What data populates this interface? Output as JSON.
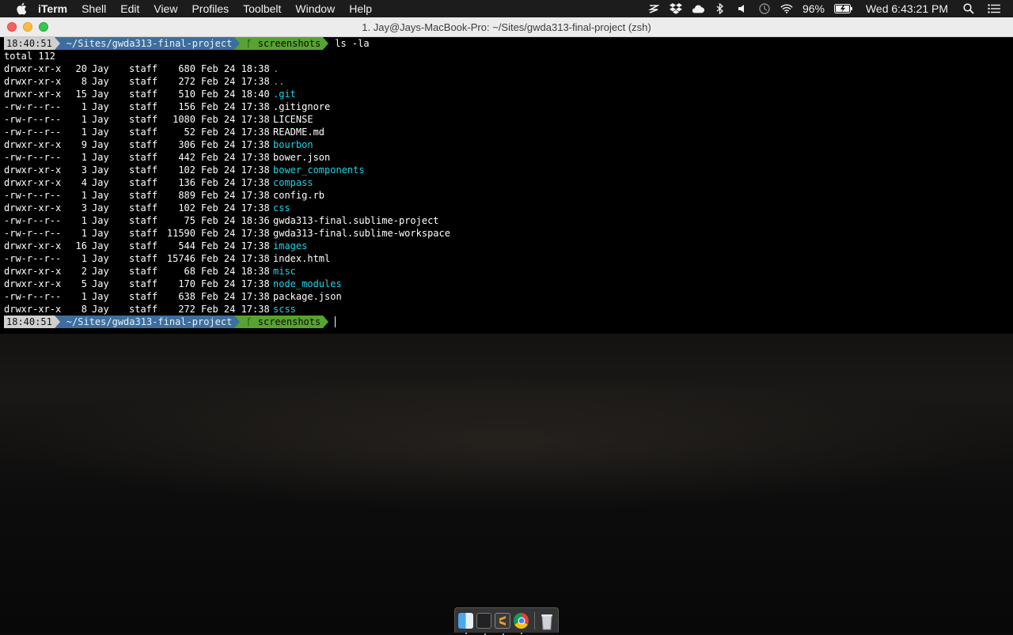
{
  "menubar": {
    "app_name": "iTerm",
    "menus": [
      "Shell",
      "Edit",
      "View",
      "Profiles",
      "Toolbelt",
      "Window",
      "Help"
    ],
    "battery_percent": "96%",
    "clock": "Wed 6:43:21 PM",
    "status_icons": [
      "dropbox-s-icon",
      "dropbox-icon",
      "cloud-icon",
      "bluetooth-icon",
      "volume-icon",
      "time-machine-icon",
      "wifi-icon",
      "battery-icon",
      "spotlight-icon",
      "notification-center-icon"
    ]
  },
  "window": {
    "title": "1. Jay@Jays-MacBook-Pro: ~/Sites/gwda313-final-project (zsh)"
  },
  "terminal": {
    "prompt1": {
      "time": "18:40:51",
      "path": "~/Sites/gwda313-final-project",
      "branch": "screenshots",
      "command": "ls -la"
    },
    "total_line": "total 112",
    "entries": [
      {
        "perm": "drwxr-xr-x",
        "links": "20",
        "owner": "Jay",
        "group": "staff",
        "size": "680",
        "date": "Feb 24 18:38",
        "name": ".",
        "dir": true
      },
      {
        "perm": "drwxr-xr-x",
        "links": "8",
        "owner": "Jay",
        "group": "staff",
        "size": "272",
        "date": "Feb 24 17:38",
        "name": "..",
        "dir": true
      },
      {
        "perm": "drwxr-xr-x",
        "links": "15",
        "owner": "Jay",
        "group": "staff",
        "size": "510",
        "date": "Feb 24 18:40",
        "name": ".git",
        "dir": true
      },
      {
        "perm": "-rw-r--r--",
        "links": "1",
        "owner": "Jay",
        "group": "staff",
        "size": "156",
        "date": "Feb 24 17:38",
        "name": ".gitignore",
        "dir": false
      },
      {
        "perm": "-rw-r--r--",
        "links": "1",
        "owner": "Jay",
        "group": "staff",
        "size": "1080",
        "date": "Feb 24 17:38",
        "name": "LICENSE",
        "dir": false
      },
      {
        "perm": "-rw-r--r--",
        "links": "1",
        "owner": "Jay",
        "group": "staff",
        "size": "52",
        "date": "Feb 24 17:38",
        "name": "README.md",
        "dir": false
      },
      {
        "perm": "drwxr-xr-x",
        "links": "9",
        "owner": "Jay",
        "group": "staff",
        "size": "306",
        "date": "Feb 24 17:38",
        "name": "bourbon",
        "dir": true
      },
      {
        "perm": "-rw-r--r--",
        "links": "1",
        "owner": "Jay",
        "group": "staff",
        "size": "442",
        "date": "Feb 24 17:38",
        "name": "bower.json",
        "dir": false
      },
      {
        "perm": "drwxr-xr-x",
        "links": "3",
        "owner": "Jay",
        "group": "staff",
        "size": "102",
        "date": "Feb 24 17:38",
        "name": "bower_components",
        "dir": true
      },
      {
        "perm": "drwxr-xr-x",
        "links": "4",
        "owner": "Jay",
        "group": "staff",
        "size": "136",
        "date": "Feb 24 17:38",
        "name": "compass",
        "dir": true
      },
      {
        "perm": "-rw-r--r--",
        "links": "1",
        "owner": "Jay",
        "group": "staff",
        "size": "889",
        "date": "Feb 24 17:38",
        "name": "config.rb",
        "dir": false
      },
      {
        "perm": "drwxr-xr-x",
        "links": "3",
        "owner": "Jay",
        "group": "staff",
        "size": "102",
        "date": "Feb 24 17:38",
        "name": "css",
        "dir": true
      },
      {
        "perm": "-rw-r--r--",
        "links": "1",
        "owner": "Jay",
        "group": "staff",
        "size": "75",
        "date": "Feb 24 18:36",
        "name": "gwda313-final.sublime-project",
        "dir": false
      },
      {
        "perm": "-rw-r--r--",
        "links": "1",
        "owner": "Jay",
        "group": "staff",
        "size": "11590",
        "date": "Feb 24 17:38",
        "name": "gwda313-final.sublime-workspace",
        "dir": false
      },
      {
        "perm": "drwxr-xr-x",
        "links": "16",
        "owner": "Jay",
        "group": "staff",
        "size": "544",
        "date": "Feb 24 17:38",
        "name": "images",
        "dir": true
      },
      {
        "perm": "-rw-r--r--",
        "links": "1",
        "owner": "Jay",
        "group": "staff",
        "size": "15746",
        "date": "Feb 24 17:38",
        "name": "index.html",
        "dir": false
      },
      {
        "perm": "drwxr-xr-x",
        "links": "2",
        "owner": "Jay",
        "group": "staff",
        "size": "68",
        "date": "Feb 24 18:38",
        "name": "misc",
        "dir": true
      },
      {
        "perm": "drwxr-xr-x",
        "links": "5",
        "owner": "Jay",
        "group": "staff",
        "size": "170",
        "date": "Feb 24 17:38",
        "name": "node_modules",
        "dir": true
      },
      {
        "perm": "-rw-r--r--",
        "links": "1",
        "owner": "Jay",
        "group": "staff",
        "size": "638",
        "date": "Feb 24 17:38",
        "name": "package.json",
        "dir": false
      },
      {
        "perm": "drwxr-xr-x",
        "links": "8",
        "owner": "Jay",
        "group": "staff",
        "size": "272",
        "date": "Feb 24 17:38",
        "name": "scss",
        "dir": true
      }
    ],
    "prompt2": {
      "time": "18:40:51",
      "path": "~/Sites/gwda313-final-project",
      "branch": "screenshots"
    }
  },
  "dock": {
    "apps": [
      "finder-icon",
      "terminal-icon",
      "sublime-text-icon",
      "chrome-icon",
      "trash-icon"
    ]
  },
  "colors": {
    "directory": "#1ed3e6",
    "prompt_time_bg": "#d0d0d0",
    "prompt_path_bg": "#3d6e9d",
    "prompt_git_bg": "#57a32f"
  }
}
